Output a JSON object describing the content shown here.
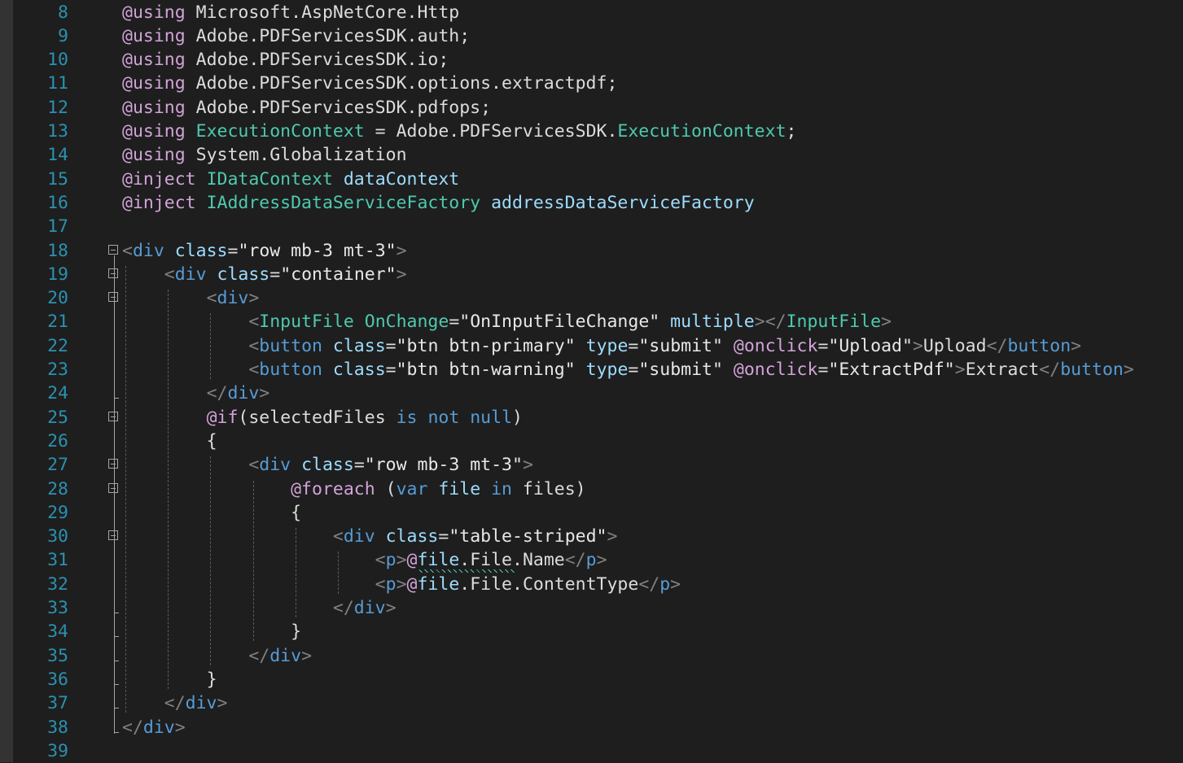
{
  "colors": {
    "background": "#1e1e1e",
    "line_number": "#2b91af",
    "directive": "#d2a3d8",
    "default": "#dcdcdc",
    "type": "#4ec9b0",
    "identifier": "#9cdcfe",
    "keyword": "#569cd6",
    "tag_bracket": "#808080",
    "html_tag": "#569cd6",
    "attribute": "#9cdcfe",
    "string": "#e8e8e8",
    "component": "#4ec9b0"
  },
  "editor": {
    "lines": [
      {
        "num": "8",
        "text": "@using Microsoft.AspNetCore.Http"
      },
      {
        "num": "9",
        "text": "@using Adobe.PDFServicesSDK.auth;"
      },
      {
        "num": "10",
        "text": "@using Adobe.PDFServicesSDK.io;"
      },
      {
        "num": "11",
        "text": "@using Adobe.PDFServicesSDK.options.extractpdf;"
      },
      {
        "num": "12",
        "text": "@using Adobe.PDFServicesSDK.pdfops;"
      },
      {
        "num": "13",
        "text": "@using ExecutionContext = Adobe.PDFServicesSDK.ExecutionContext;"
      },
      {
        "num": "14",
        "text": "@using System.Globalization"
      },
      {
        "num": "15",
        "text": "@inject IDataContext dataContext"
      },
      {
        "num": "16",
        "text": "@inject IAddressDataServiceFactory addressDataServiceFactory"
      },
      {
        "num": "17",
        "text": ""
      },
      {
        "num": "18",
        "text": "<div class=\"row mb-3 mt-3\">"
      },
      {
        "num": "19",
        "text": "    <div class=\"container\">"
      },
      {
        "num": "20",
        "text": "        <div>"
      },
      {
        "num": "21",
        "text": "            <InputFile OnChange=\"OnInputFileChange\" multiple></InputFile>"
      },
      {
        "num": "22",
        "text": "            <button class=\"btn btn-primary\" type=\"submit\" @onclick=\"Upload\">Upload</button>"
      },
      {
        "num": "23",
        "text": "            <button class=\"btn btn-warning\" type=\"submit\" @onclick=\"ExtractPdf\">Extract</button>"
      },
      {
        "num": "24",
        "text": "        </div>"
      },
      {
        "num": "25",
        "text": "        @if(selectedFiles is not null)"
      },
      {
        "num": "26",
        "text": "        {"
      },
      {
        "num": "27",
        "text": "            <div class=\"row mb-3 mt-3\">"
      },
      {
        "num": "28",
        "text": "                @foreach (var file in files)"
      },
      {
        "num": "29",
        "text": "                {"
      },
      {
        "num": "30",
        "text": "                    <div class=\"table-striped\">"
      },
      {
        "num": "31",
        "text": "                        <p>@file.File.Name</p>"
      },
      {
        "num": "32",
        "text": "                        <p>@file.File.ContentType</p>"
      },
      {
        "num": "33",
        "text": "                    </div>"
      },
      {
        "num": "34",
        "text": "                }"
      },
      {
        "num": "35",
        "text": "            </div>"
      },
      {
        "num": "36",
        "text": "        }"
      },
      {
        "num": "37",
        "text": "    </div>"
      },
      {
        "num": "38",
        "text": "</div>"
      },
      {
        "num": "39",
        "text": ""
      }
    ]
  }
}
